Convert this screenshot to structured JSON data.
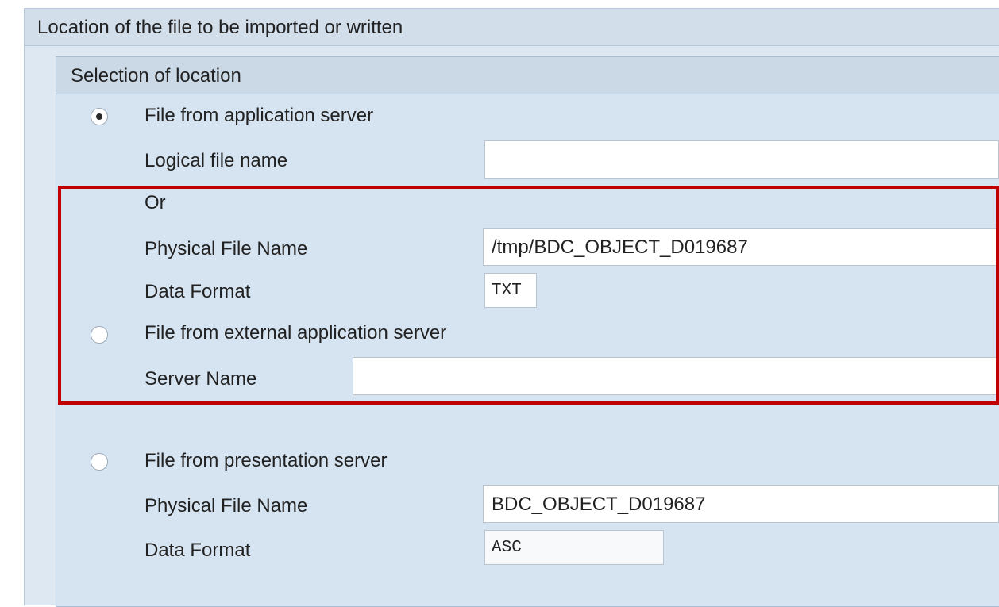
{
  "outer": {
    "title": "Location of the file to be imported or written"
  },
  "inner": {
    "title": "Selection of location"
  },
  "app_server": {
    "radio_label": "File from application server",
    "selected": true,
    "logical_label": "Logical file name",
    "logical_value": "",
    "or_label": "Or",
    "physical_label": "Physical File Name",
    "physical_value": "/tmp/BDC_OBJECT_D019687",
    "format_label": "Data Format",
    "format_value": "TXT"
  },
  "external_server": {
    "radio_label": "File from external application server",
    "selected": false,
    "server_label": "Server Name",
    "server_value": ""
  },
  "presentation_server": {
    "radio_label": "File from presentation server",
    "selected": false,
    "physical_label": "Physical File Name",
    "physical_value": "BDC_OBJECT_D019687",
    "format_label": "Data Format",
    "format_value": "ASC"
  },
  "colors": {
    "highlight": "#c00000",
    "panel": "#d6e4f1"
  }
}
